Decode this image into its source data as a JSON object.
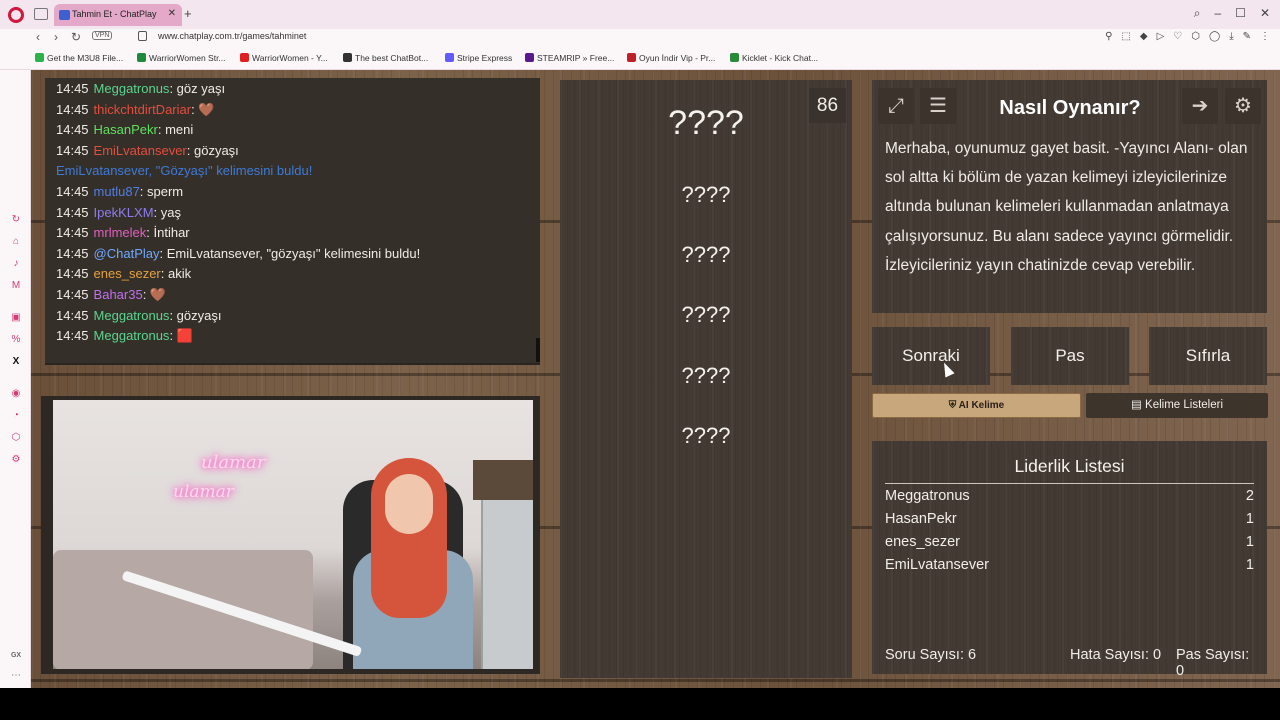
{
  "browser": {
    "tab_title": "Tahmin Et - ChatPlay",
    "url": "www.chatplay.com.tr/games/tahminet",
    "vpn_label": "VPN",
    "bookmarks": [
      {
        "label": "Get the M3U8 File...",
        "color": "#2bb34a"
      },
      {
        "label": "WarriorWomen Str...",
        "color": "#1f8a3c"
      },
      {
        "label": "WarriorWomen - Y...",
        "color": "#e02020"
      },
      {
        "label": "The best ChatBot...",
        "color": "#333333"
      },
      {
        "label": "Stripe Express",
        "color": "#635bff"
      },
      {
        "label": "STEAMRIP » Free...",
        "color": "#5a1a8c"
      },
      {
        "label": "Oyun İndir Vip - Pr...",
        "color": "#c0202a"
      },
      {
        "label": "Kicklet - Kick Chat...",
        "color": "#2a8a3a"
      }
    ],
    "sidebar_bottom": "GX"
  },
  "chat": {
    "messages": [
      {
        "time": "14:45",
        "user": "Meggatronus",
        "color": "#58d68d",
        "text": ": göz yaşı"
      },
      {
        "time": "14:45",
        "user": "thickchtdirtDariar",
        "color": "#e74c3c",
        "text": ": 🤎"
      },
      {
        "time": "14:45",
        "user": "HasanPekr",
        "color": "#5fe05f",
        "text": ": meni"
      },
      {
        "time": "14:45",
        "user": "EmiLvatansever",
        "color": "#e74c3c",
        "text": ": gözyaşı"
      },
      {
        "time": "",
        "user": "",
        "color": "#3c7bd9",
        "text": "EmiLvatansever, \"Gözyaşı\" kelimesini buldu!"
      },
      {
        "time": "14:45",
        "user": "mutlu87",
        "color": "#4f7fe3",
        "text": ": sperm"
      },
      {
        "time": "14:45",
        "user": "IpekKLXM",
        "color": "#8e7cf0",
        "text": ": yaş"
      },
      {
        "time": "14:45",
        "user": "mrlmelek",
        "color": "#e060c0",
        "text": ": İntihar"
      },
      {
        "time": "14:45",
        "user": "@ChatPlay",
        "color": "#6fa8ff",
        "text": ": EmiLvatansever, \"gözyaşı\" kelimesini buldu!"
      },
      {
        "time": "14:45",
        "user": "enes_sezer",
        "color": "#e6a23c",
        "text": ": akik"
      },
      {
        "time": "14:45",
        "user": "Bahar35",
        "color": "#c070f0",
        "text": ": 🤎"
      },
      {
        "time": "14:45",
        "user": "Meggatronus",
        "color": "#58d68d",
        "text": ": gözyaşı"
      },
      {
        "time": "14:45",
        "user": "Meggatronus",
        "color": "#58d68d",
        "text": ": 🟥"
      }
    ]
  },
  "stream": {
    "neon_line1": "ulamar",
    "neon_line2": "ulamar"
  },
  "game": {
    "counter": "86",
    "hidden_words": [
      "????",
      "????",
      "????",
      "????",
      "????",
      "????"
    ]
  },
  "help": {
    "title": "Nasıl Oynanır?",
    "text": "Merhaba, oyunumuz gayet basit. -Yayıncı Alanı- olan sol altta ki bölüm de yazan kelimeyi izleyicilerinize altında bulunan kelimeleri kullanmadan anlatmaya çalışıyorsunuz. Bu alanı sadece yayıncı görmelidir. İzleyicileriniz yayın chatinizde cevap verebilir."
  },
  "actions": {
    "next": "Sonraki",
    "pass": "Pas",
    "reset": "Sıfırla",
    "ai_word": "AI Kelime",
    "word_lists": "Kelime Listeleri"
  },
  "leaderboard": {
    "title": "Liderlik Listesi",
    "rows": [
      {
        "name": "Meggatronus",
        "score": "2"
      },
      {
        "name": "HasanPekr",
        "score": "1"
      },
      {
        "name": "enes_sezer",
        "score": "1"
      },
      {
        "name": "EmiLvatansever",
        "score": "1"
      }
    ]
  },
  "stats": {
    "questions": "Soru Sayısı: 6",
    "errors": "Hata Sayısı: 0",
    "passes": "Pas Sayısı: 0"
  }
}
